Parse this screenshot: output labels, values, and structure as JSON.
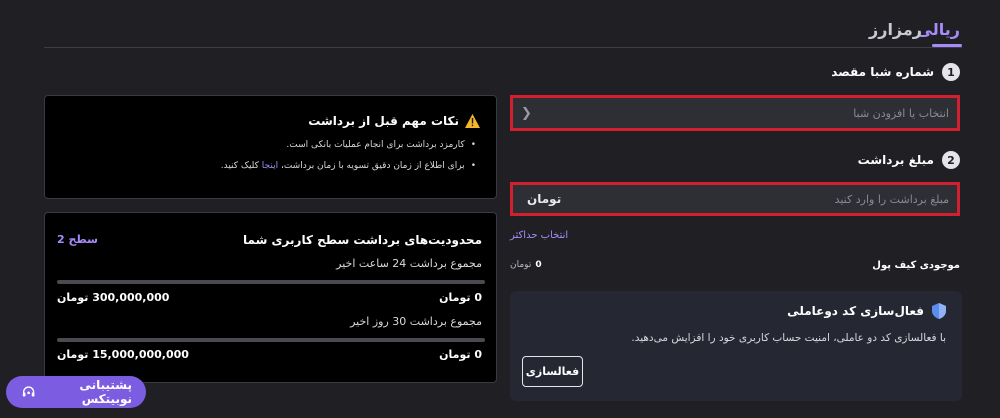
{
  "tabs": {
    "active": "ریالی",
    "inactive": "رمزارز"
  },
  "step1": {
    "number": "1",
    "label": "شماره شبا مقصد",
    "placeholder": "انتخاب یا افزودن شبا"
  },
  "step2": {
    "number": "2",
    "label": "مبلغ برداشت",
    "placeholder": "مبلغ برداشت را وارد کنید",
    "unit": "تومان",
    "max_link": "انتخاب حداکثر"
  },
  "wallet": {
    "label": "موجودی کیف پول",
    "value": "0",
    "unit": "تومان"
  },
  "tfa": {
    "title": "فعال‌سازی کد دوعاملی",
    "description": "با فعالسازی کد دو عاملی، امنیت حساب کاربری خود را افزایش می‌دهید.",
    "button": "فعالسازی"
  },
  "notes": {
    "title": "نکات مهم قبل از برداشت",
    "item1": "کارمزد برداشت برای انجام عملیات بانکی است.",
    "item2_prefix": "برای اطلاع از زمان دقیق تسویه با زمان برداشت، ",
    "item2_link": "اینجا",
    "item2_suffix": " کلیک کنید."
  },
  "limits": {
    "title": "محدودیت‌های برداشت سطح کاربری شما",
    "level": "سطح 2",
    "daily": {
      "label": "مجموع برداشت 24 ساعت اخیر",
      "used": "0 تومان",
      "max": "300,000,000 تومان"
    },
    "monthly": {
      "label": "مجموع برداشت 30 روز اخیر",
      "used": "0 تومان",
      "max": "15,000,000,000 تومان"
    }
  },
  "support": {
    "label": "پشتیبانی نوبیتکس"
  }
}
